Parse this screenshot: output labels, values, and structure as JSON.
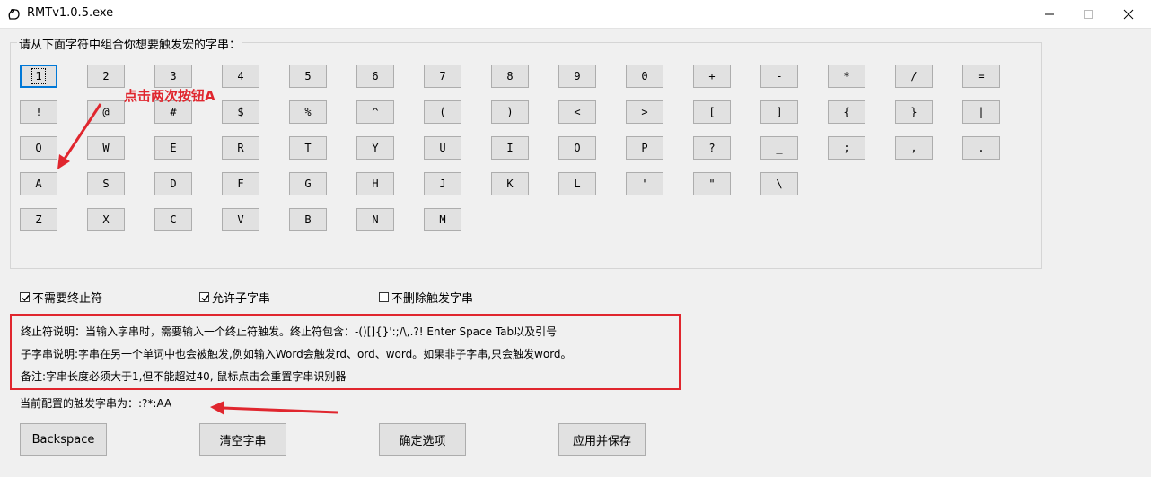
{
  "window": {
    "title": "RMTv1.0.5.exe",
    "controls": [
      "—",
      "☐",
      "✕"
    ]
  },
  "group": {
    "label": "请从下面字符中组合你想要触发宏的字串："
  },
  "keys": [
    [
      "1",
      "2",
      "3",
      "4",
      "5",
      "6",
      "7",
      "8",
      "9",
      "0",
      "+",
      "-",
      "*",
      "/",
      "="
    ],
    [
      "!",
      "@",
      "#",
      "$",
      "%",
      "^",
      "(",
      ")",
      "<",
      ">",
      "[",
      "]",
      "{",
      "}",
      "|"
    ],
    [
      "Q",
      "W",
      "E",
      "R",
      "T",
      "Y",
      "U",
      "I",
      "O",
      "P",
      "?",
      "_",
      ";",
      ",",
      "."
    ],
    [
      "A",
      "S",
      "D",
      "F",
      "G",
      "H",
      "J",
      "K",
      "L",
      "'",
      "\"",
      "\\"
    ],
    [
      "Z",
      "X",
      "C",
      "V",
      "B",
      "N",
      "M"
    ]
  ],
  "checkboxes": [
    {
      "label": "不需要终止符",
      "checked": true
    },
    {
      "label": "允许子字串",
      "checked": true
    },
    {
      "label": "不删除触发字串",
      "checked": false
    }
  ],
  "info": {
    "line1": "终止符说明：当输入字串时，需要输入一个终止符触发。终止符包含：-()[]{}':;/\\,.?! Enter Space Tab以及引号",
    "line2": "子字串说明:字串在另一个单词中也会被触发,例如输入Word会触发rd、ord、word。如果非子字串,只会触发word。",
    "line3": "备注:字串长度必须大于1,但不能超过40, 鼠标点击会重置字串识别器"
  },
  "current_trigger": "当前配置的触发字串为：:?*:AA",
  "buttons": {
    "backspace": "Backspace",
    "clear": "清空字串",
    "confirm": "确定选项",
    "apply": "应用并保存"
  },
  "annotation": "点击两次按钮A",
  "colors": {
    "annotation_red": "#e0262e",
    "focus_blue": "#0078d7"
  }
}
